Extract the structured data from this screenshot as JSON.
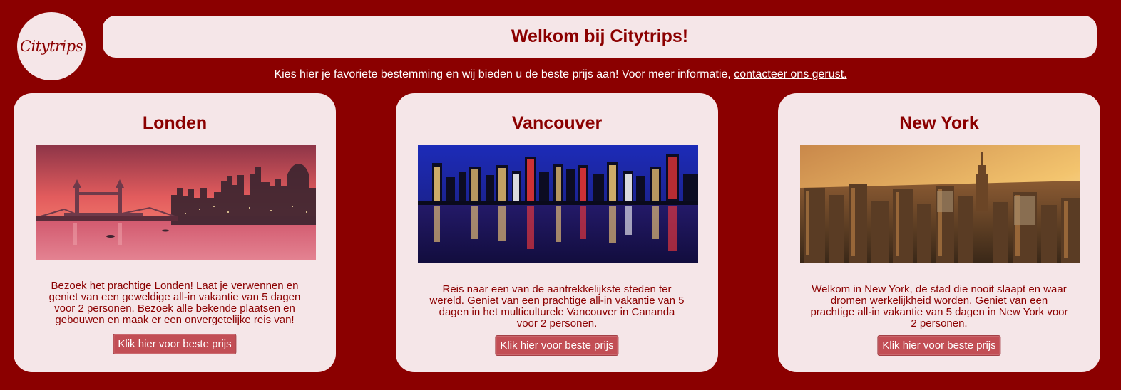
{
  "logo": {
    "text": "Citytrips"
  },
  "header": {
    "title": "Welkom bij Citytrips!"
  },
  "intro": {
    "text": "Kies hier je favoriete bestemming en wij bieden u de beste prijs aan! Voor meer informatie, ",
    "link_label": "contacteer ons gerust."
  },
  "cities": [
    {
      "name": "Londen",
      "image_icon": "london-skyline-sunset-photo",
      "description": "Bezoek het prachtige Londen! Laat je verwennen en geniet van een geweldige all-in vakantie van 5 dagen voor 2 personen. Bezoek alle bekende plaatsen en gebouwen en maak er een onvergetelijke reis van!",
      "button_label": "Klik hier voor beste prijs"
    },
    {
      "name": "Vancouver",
      "image_icon": "vancouver-night-skyline-photo",
      "description": "Reis naar een van de aantrekkelijkste steden ter wereld. Geniet van een prachtige all-in vakantie van 5 dagen in het multiculturele Vancouver in Cananda voor 2 personen.",
      "button_label": "Klik hier voor beste prijs"
    },
    {
      "name": "New York",
      "image_icon": "new-york-golden-skyline-photo",
      "description": "Welkom in New York, de stad die nooit slaapt en waar dromen werkelijkheid worden. Geniet van een prachtige all-in vakantie van 5 dagen in New York voor 2 personen.",
      "button_label": "Klik hier voor beste prijs"
    }
  ],
  "colors": {
    "background": "#8b0000",
    "panel": "#f5e6e8",
    "accent_text": "#8b0000",
    "button": "#c24e55"
  }
}
